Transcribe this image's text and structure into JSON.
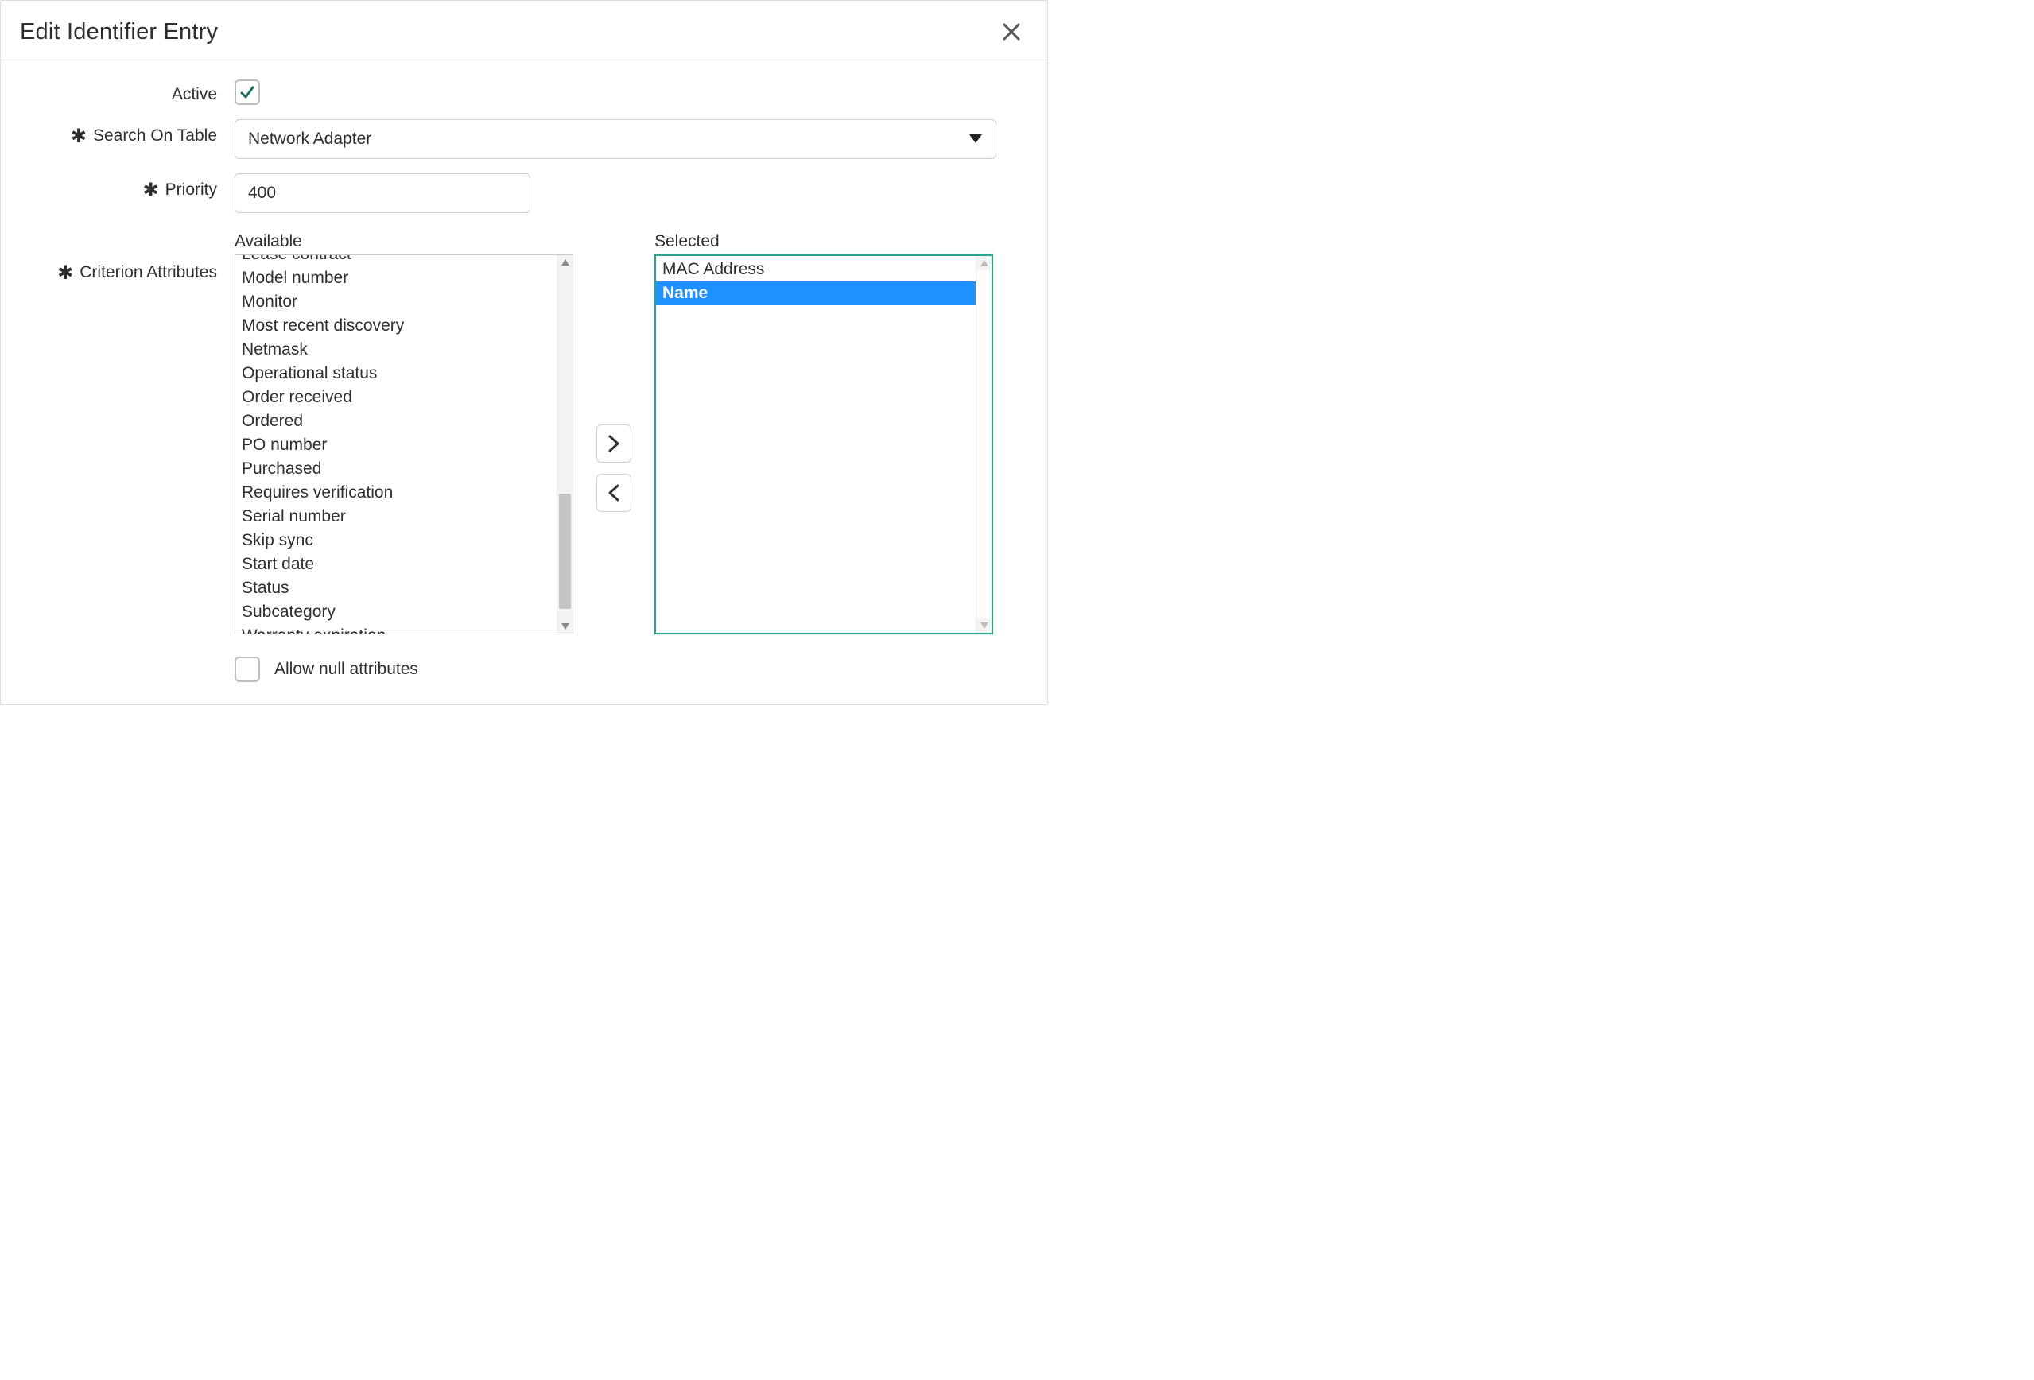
{
  "dialog": {
    "title": "Edit Identifier Entry"
  },
  "fields": {
    "active": {
      "label": "Active",
      "checked": true
    },
    "search_on_table": {
      "label": "Search On Table",
      "value": "Network Adapter"
    },
    "priority": {
      "label": "Priority",
      "value": "400"
    },
    "criterion": {
      "label": "Criterion Attributes"
    },
    "allow_null": {
      "label": "Allow null attributes",
      "checked": false
    }
  },
  "slush": {
    "available_label": "Available",
    "selected_label": "Selected",
    "available": [
      "Lease contract",
      "Model number",
      "Monitor",
      "Most recent discovery",
      "Netmask",
      "Operational status",
      "Order received",
      "Ordered",
      "PO number",
      "Purchased",
      "Requires verification",
      "Serial number",
      "Skip sync",
      "Start date",
      "Status",
      "Subcategory",
      "Warranty expiration"
    ],
    "selected": [
      {
        "label": "MAC Address",
        "highlighted": false
      },
      {
        "label": "Name",
        "highlighted": true
      }
    ]
  }
}
